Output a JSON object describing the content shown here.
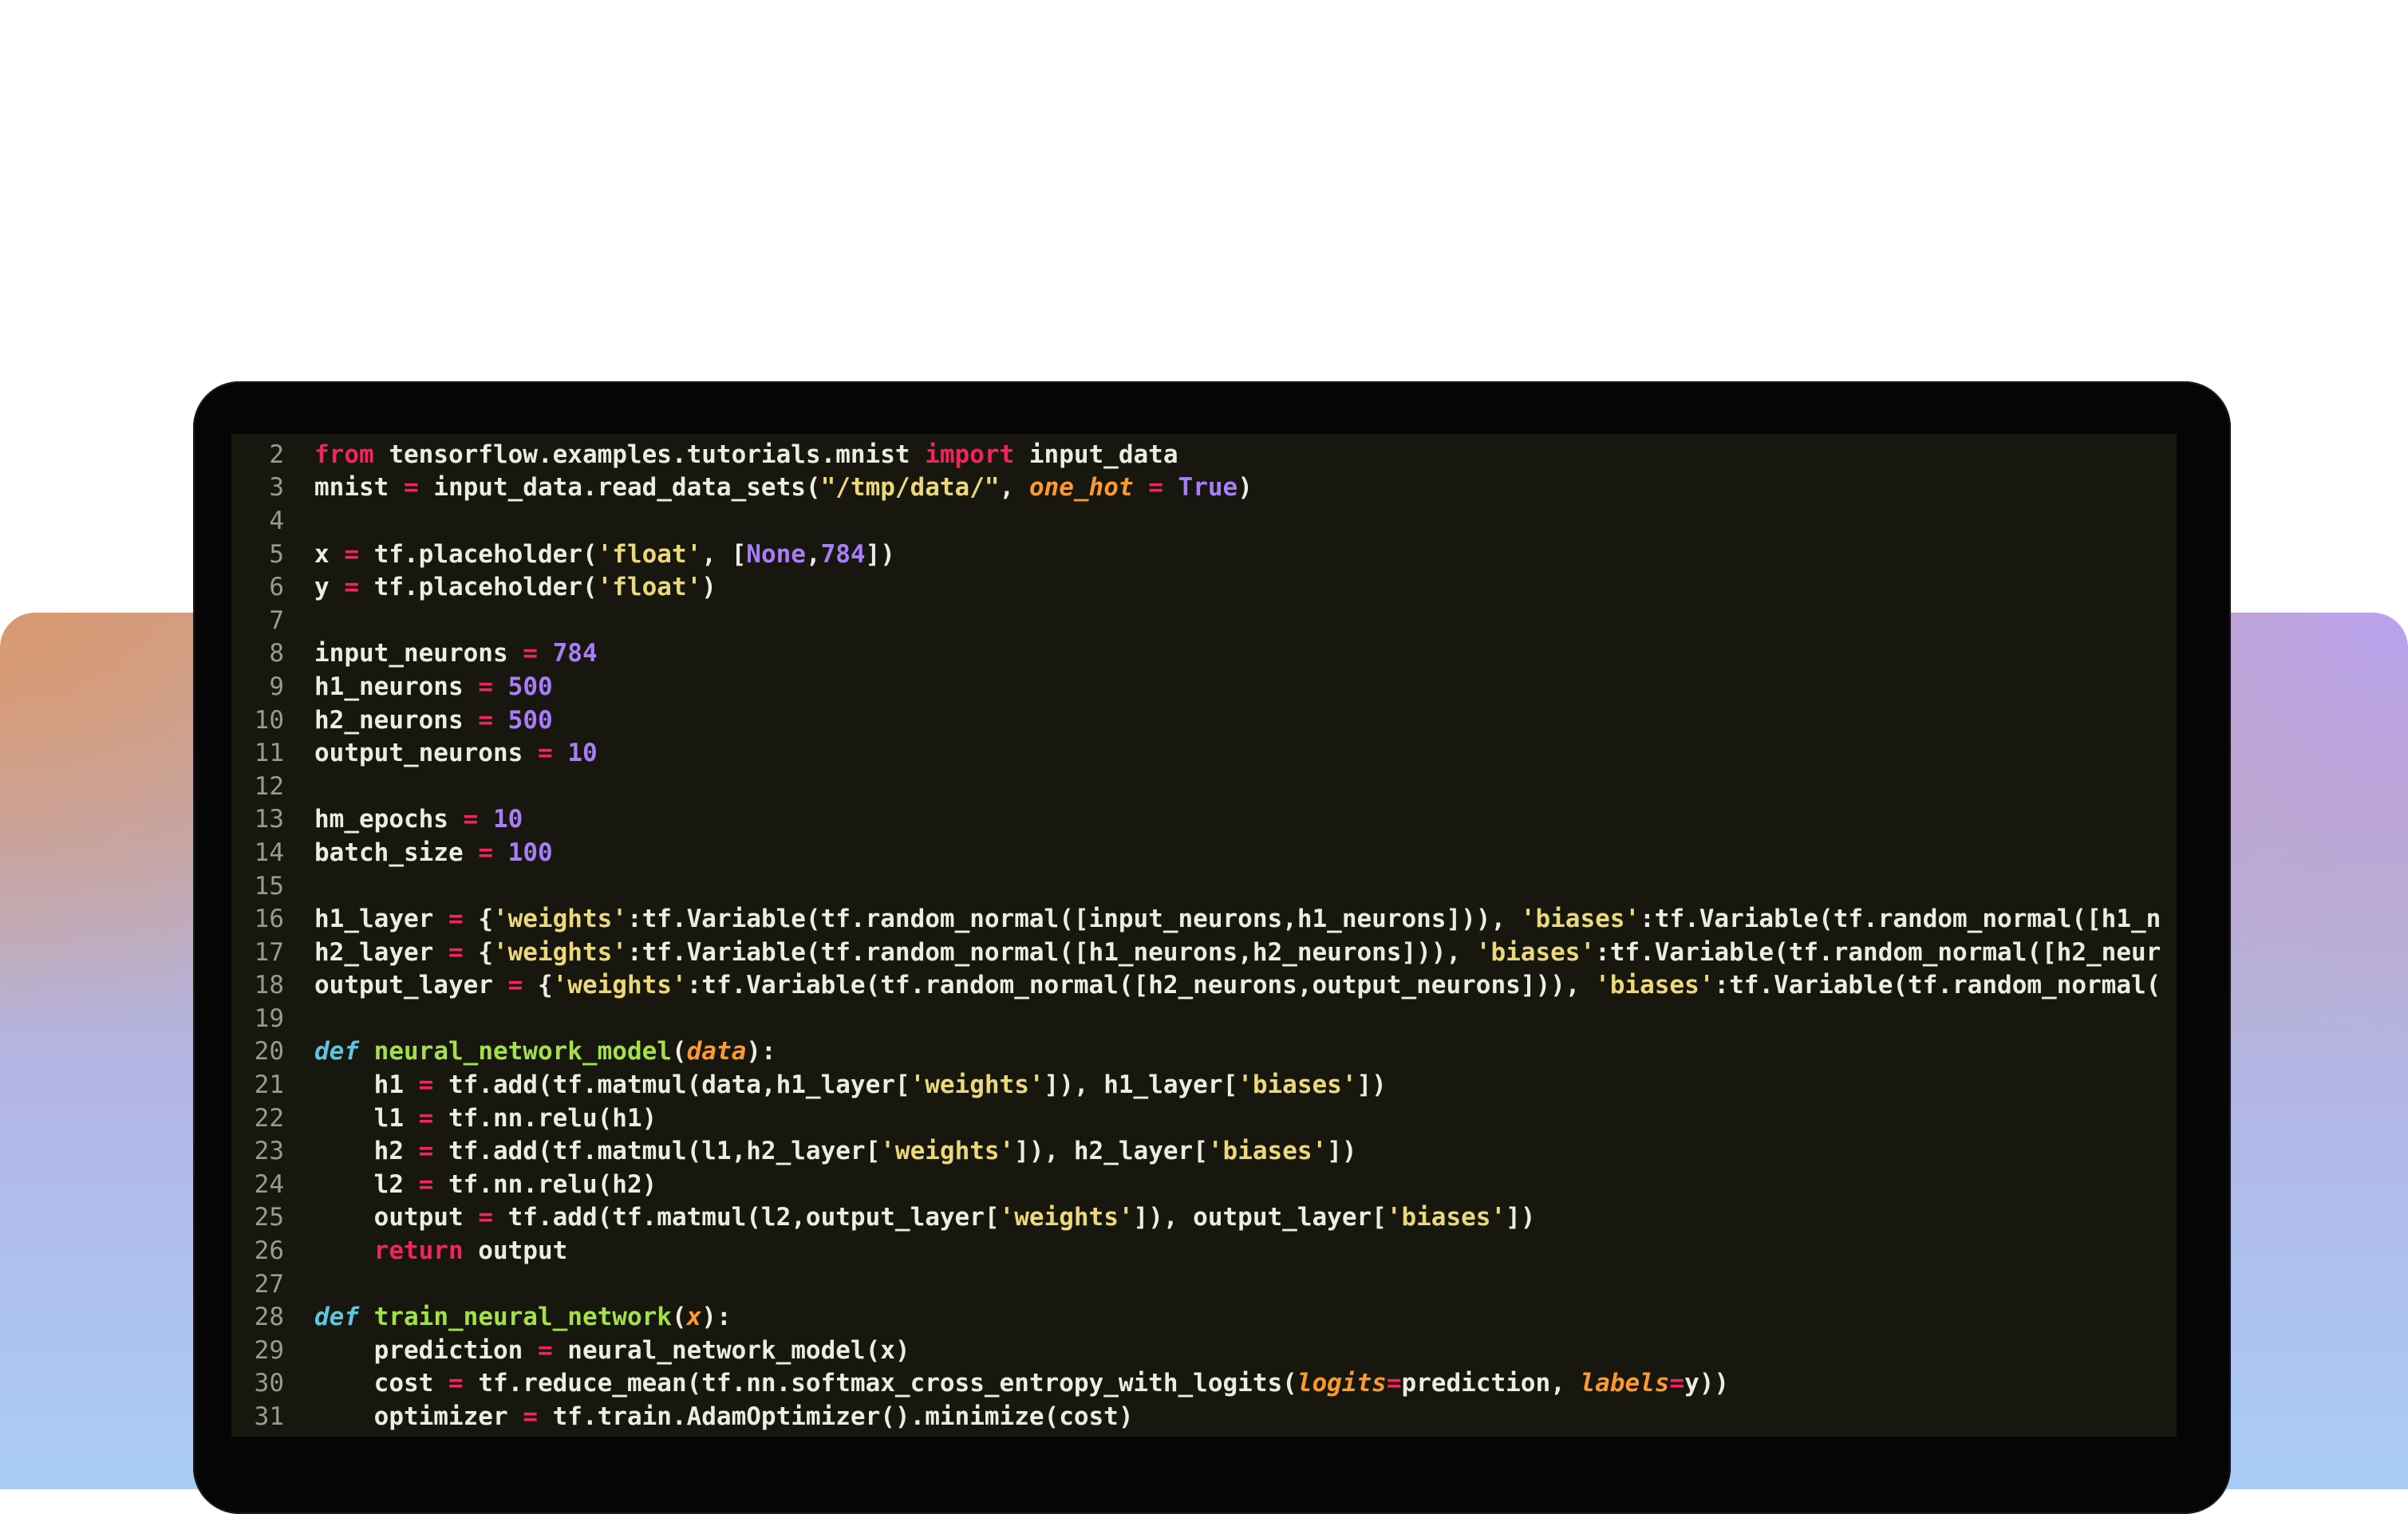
{
  "editor": {
    "lines": [
      {
        "n": "2",
        "tokens": [
          [
            "kw",
            "from"
          ],
          [
            "t",
            " tensorflow.examples.tutorials.mnist "
          ],
          [
            "kw",
            "import"
          ],
          [
            "t",
            " input_data"
          ]
        ]
      },
      {
        "n": "3",
        "tokens": [
          [
            "t",
            "mnist "
          ],
          [
            "op",
            "="
          ],
          [
            "t",
            " input_data.read_data_sets("
          ],
          [
            "str",
            "\"/tmp/data/\""
          ],
          [
            "t",
            ", "
          ],
          [
            "param",
            "one_hot"
          ],
          [
            "t",
            " "
          ],
          [
            "op",
            "="
          ],
          [
            "t",
            " "
          ],
          [
            "const",
            "True"
          ],
          [
            "t",
            ")"
          ]
        ]
      },
      {
        "n": "4",
        "tokens": []
      },
      {
        "n": "5",
        "tokens": [
          [
            "t",
            "x "
          ],
          [
            "op",
            "="
          ],
          [
            "t",
            " tf.placeholder("
          ],
          [
            "str",
            "'float'"
          ],
          [
            "t",
            ", ["
          ],
          [
            "const",
            "None"
          ],
          [
            "t",
            ","
          ],
          [
            "num",
            "784"
          ],
          [
            "t",
            "])"
          ]
        ]
      },
      {
        "n": "6",
        "tokens": [
          [
            "t",
            "y "
          ],
          [
            "op",
            "="
          ],
          [
            "t",
            " tf.placeholder("
          ],
          [
            "str",
            "'float'"
          ],
          [
            "t",
            ")"
          ]
        ]
      },
      {
        "n": "7",
        "tokens": []
      },
      {
        "n": "8",
        "tokens": [
          [
            "t",
            "input_neurons "
          ],
          [
            "op",
            "="
          ],
          [
            "t",
            " "
          ],
          [
            "num",
            "784"
          ]
        ]
      },
      {
        "n": "9",
        "tokens": [
          [
            "t",
            "h1_neurons "
          ],
          [
            "op",
            "="
          ],
          [
            "t",
            " "
          ],
          [
            "num",
            "500"
          ]
        ]
      },
      {
        "n": "10",
        "tokens": [
          [
            "t",
            "h2_neurons "
          ],
          [
            "op",
            "="
          ],
          [
            "t",
            " "
          ],
          [
            "num",
            "500"
          ]
        ]
      },
      {
        "n": "11",
        "tokens": [
          [
            "t",
            "output_neurons "
          ],
          [
            "op",
            "="
          ],
          [
            "t",
            " "
          ],
          [
            "num",
            "10"
          ]
        ]
      },
      {
        "n": "12",
        "tokens": []
      },
      {
        "n": "13",
        "tokens": [
          [
            "t",
            "hm_epochs "
          ],
          [
            "op",
            "="
          ],
          [
            "t",
            " "
          ],
          [
            "num",
            "10"
          ]
        ]
      },
      {
        "n": "14",
        "tokens": [
          [
            "t",
            "batch_size "
          ],
          [
            "op",
            "="
          ],
          [
            "t",
            " "
          ],
          [
            "num",
            "100"
          ]
        ]
      },
      {
        "n": "15",
        "tokens": []
      },
      {
        "n": "16",
        "tokens": [
          [
            "t",
            "h1_layer "
          ],
          [
            "op",
            "="
          ],
          [
            "t",
            " {"
          ],
          [
            "str",
            "'weights'"
          ],
          [
            "t",
            ":tf.Variable(tf.random_normal([input_neurons,h1_neurons])), "
          ],
          [
            "str",
            "'biases'"
          ],
          [
            "t",
            ":tf.Variable(tf.random_normal([h1_n"
          ]
        ]
      },
      {
        "n": "17",
        "tokens": [
          [
            "t",
            "h2_layer "
          ],
          [
            "op",
            "="
          ],
          [
            "t",
            " {"
          ],
          [
            "str",
            "'weights'"
          ],
          [
            "t",
            ":tf.Variable(tf.random_normal([h1_neurons,h2_neurons])), "
          ],
          [
            "str",
            "'biases'"
          ],
          [
            "t",
            ":tf.Variable(tf.random_normal([h2_neur"
          ]
        ]
      },
      {
        "n": "18",
        "tokens": [
          [
            "t",
            "output_layer "
          ],
          [
            "op",
            "="
          ],
          [
            "t",
            " {"
          ],
          [
            "str",
            "'weights'"
          ],
          [
            "t",
            ":tf.Variable(tf.random_normal([h2_neurons,output_neurons])), "
          ],
          [
            "str",
            "'biases'"
          ],
          [
            "t",
            ":tf.Variable(tf.random_normal("
          ]
        ]
      },
      {
        "n": "19",
        "tokens": []
      },
      {
        "n": "20",
        "tokens": [
          [
            "def",
            "def"
          ],
          [
            "t",
            " "
          ],
          [
            "fn",
            "neural_network_model"
          ],
          [
            "t",
            "("
          ],
          [
            "param",
            "data"
          ],
          [
            "t",
            "):"
          ]
        ]
      },
      {
        "n": "21",
        "tokens": [
          [
            "t",
            "    h1 "
          ],
          [
            "op",
            "="
          ],
          [
            "t",
            " tf.add(tf.matmul(data,h1_layer["
          ],
          [
            "str",
            "'weights'"
          ],
          [
            "t",
            "]), h1_layer["
          ],
          [
            "str",
            "'biases'"
          ],
          [
            "t",
            "])"
          ]
        ]
      },
      {
        "n": "22",
        "tokens": [
          [
            "t",
            "    l1 "
          ],
          [
            "op",
            "="
          ],
          [
            "t",
            " tf.nn.relu(h1)"
          ]
        ]
      },
      {
        "n": "23",
        "tokens": [
          [
            "t",
            "    h2 "
          ],
          [
            "op",
            "="
          ],
          [
            "t",
            " tf.add(tf.matmul(l1,h2_layer["
          ],
          [
            "str",
            "'weights'"
          ],
          [
            "t",
            "]), h2_layer["
          ],
          [
            "str",
            "'biases'"
          ],
          [
            "t",
            "])"
          ]
        ]
      },
      {
        "n": "24",
        "tokens": [
          [
            "t",
            "    l2 "
          ],
          [
            "op",
            "="
          ],
          [
            "t",
            " tf.nn.relu(h2)"
          ]
        ]
      },
      {
        "n": "25",
        "tokens": [
          [
            "t",
            "    output "
          ],
          [
            "op",
            "="
          ],
          [
            "t",
            " tf.add(tf.matmul(l2,output_layer["
          ],
          [
            "str",
            "'weights'"
          ],
          [
            "t",
            "]), output_layer["
          ],
          [
            "str",
            "'biases'"
          ],
          [
            "t",
            "])"
          ]
        ]
      },
      {
        "n": "26",
        "tokens": [
          [
            "t",
            "    "
          ],
          [
            "ctl",
            "return"
          ],
          [
            "t",
            " output"
          ]
        ]
      },
      {
        "n": "27",
        "tokens": []
      },
      {
        "n": "28",
        "tokens": [
          [
            "def",
            "def"
          ],
          [
            "t",
            " "
          ],
          [
            "fn",
            "train_neural_network"
          ],
          [
            "t",
            "("
          ],
          [
            "param",
            "x"
          ],
          [
            "t",
            "):"
          ]
        ]
      },
      {
        "n": "29",
        "tokens": [
          [
            "t",
            "    prediction "
          ],
          [
            "op",
            "="
          ],
          [
            "t",
            " neural_network_model(x)"
          ]
        ]
      },
      {
        "n": "30",
        "tokens": [
          [
            "t",
            "    cost "
          ],
          [
            "op",
            "="
          ],
          [
            "t",
            " tf.reduce_mean(tf.nn.softmax_cross_entropy_with_logits("
          ],
          [
            "param",
            "logits"
          ],
          [
            "op",
            "="
          ],
          [
            "t",
            "prediction, "
          ],
          [
            "param",
            "labels"
          ],
          [
            "op",
            "="
          ],
          [
            "t",
            "y))"
          ]
        ]
      },
      {
        "n": "31",
        "tokens": [
          [
            "t",
            "    optimizer "
          ],
          [
            "op",
            "="
          ],
          [
            "t",
            " tf.train.AdamOptimizer().minimize(cost)"
          ]
        ]
      }
    ]
  },
  "colors": {
    "keyword": "#f2245a",
    "number": "#a77ef7",
    "string": "#ecd87a",
    "def": "#5fc6e0",
    "function": "#a3e04a",
    "parameter": "#fd9a2a",
    "text": "#ecece4",
    "background": "#17170f"
  }
}
